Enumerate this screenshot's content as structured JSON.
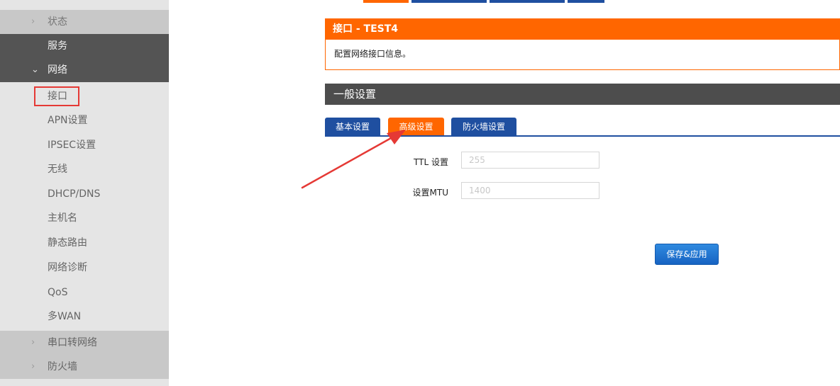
{
  "sidebar": {
    "items": [
      {
        "label": "状态",
        "chevron": "›",
        "style": "top"
      },
      {
        "label": "服务",
        "chevron": "",
        "style": "dark"
      },
      {
        "label": "网络",
        "chevron": "⌄",
        "style": "dark"
      },
      {
        "label": "接口",
        "chevron": "",
        "style": "sub"
      },
      {
        "label": "APN设置",
        "chevron": "",
        "style": "sub"
      },
      {
        "label": "IPSEC设置",
        "chevron": "",
        "style": "sub"
      },
      {
        "label": "无线",
        "chevron": "",
        "style": "sub"
      },
      {
        "label": "DHCP/DNS",
        "chevron": "",
        "style": "sub"
      },
      {
        "label": "主机名",
        "chevron": "",
        "style": "sub"
      },
      {
        "label": "静态路由",
        "chevron": "",
        "style": "sub"
      },
      {
        "label": "网络诊断",
        "chevron": "",
        "style": "sub"
      },
      {
        "label": "QoS",
        "chevron": "",
        "style": "sub"
      },
      {
        "label": "多WAN",
        "chevron": "",
        "style": "sub"
      },
      {
        "label": "串口转网络",
        "chevron": "›",
        "style": "collapsed"
      },
      {
        "label": "防火墙",
        "chevron": "›",
        "style": "collapsed"
      }
    ]
  },
  "panel": {
    "title": "接口 - TEST4",
    "description": "配置网络接口信息。"
  },
  "section": {
    "title": "一般设置"
  },
  "tabs": [
    {
      "label": "基本设置",
      "active": false
    },
    {
      "label": "高级设置",
      "active": true
    },
    {
      "label": "防火墙设置",
      "active": false
    }
  ],
  "form": {
    "ttl": {
      "label": "TTL 设置",
      "placeholder": "255",
      "value": ""
    },
    "mtu": {
      "label": "设置MTU",
      "placeholder": "1400",
      "value": ""
    }
  },
  "actions": {
    "save_label": "保存&应用"
  },
  "colors": {
    "accent_orange": "#ff6600",
    "tab_blue": "#1f4fa0",
    "section_dark": "#4d4d4d",
    "highlight_red": "#e53935"
  },
  "icons": {
    "collapsed": "chevron-right-icon",
    "expanded": "chevron-down-icon",
    "annotation": "red-arrow-icon"
  }
}
